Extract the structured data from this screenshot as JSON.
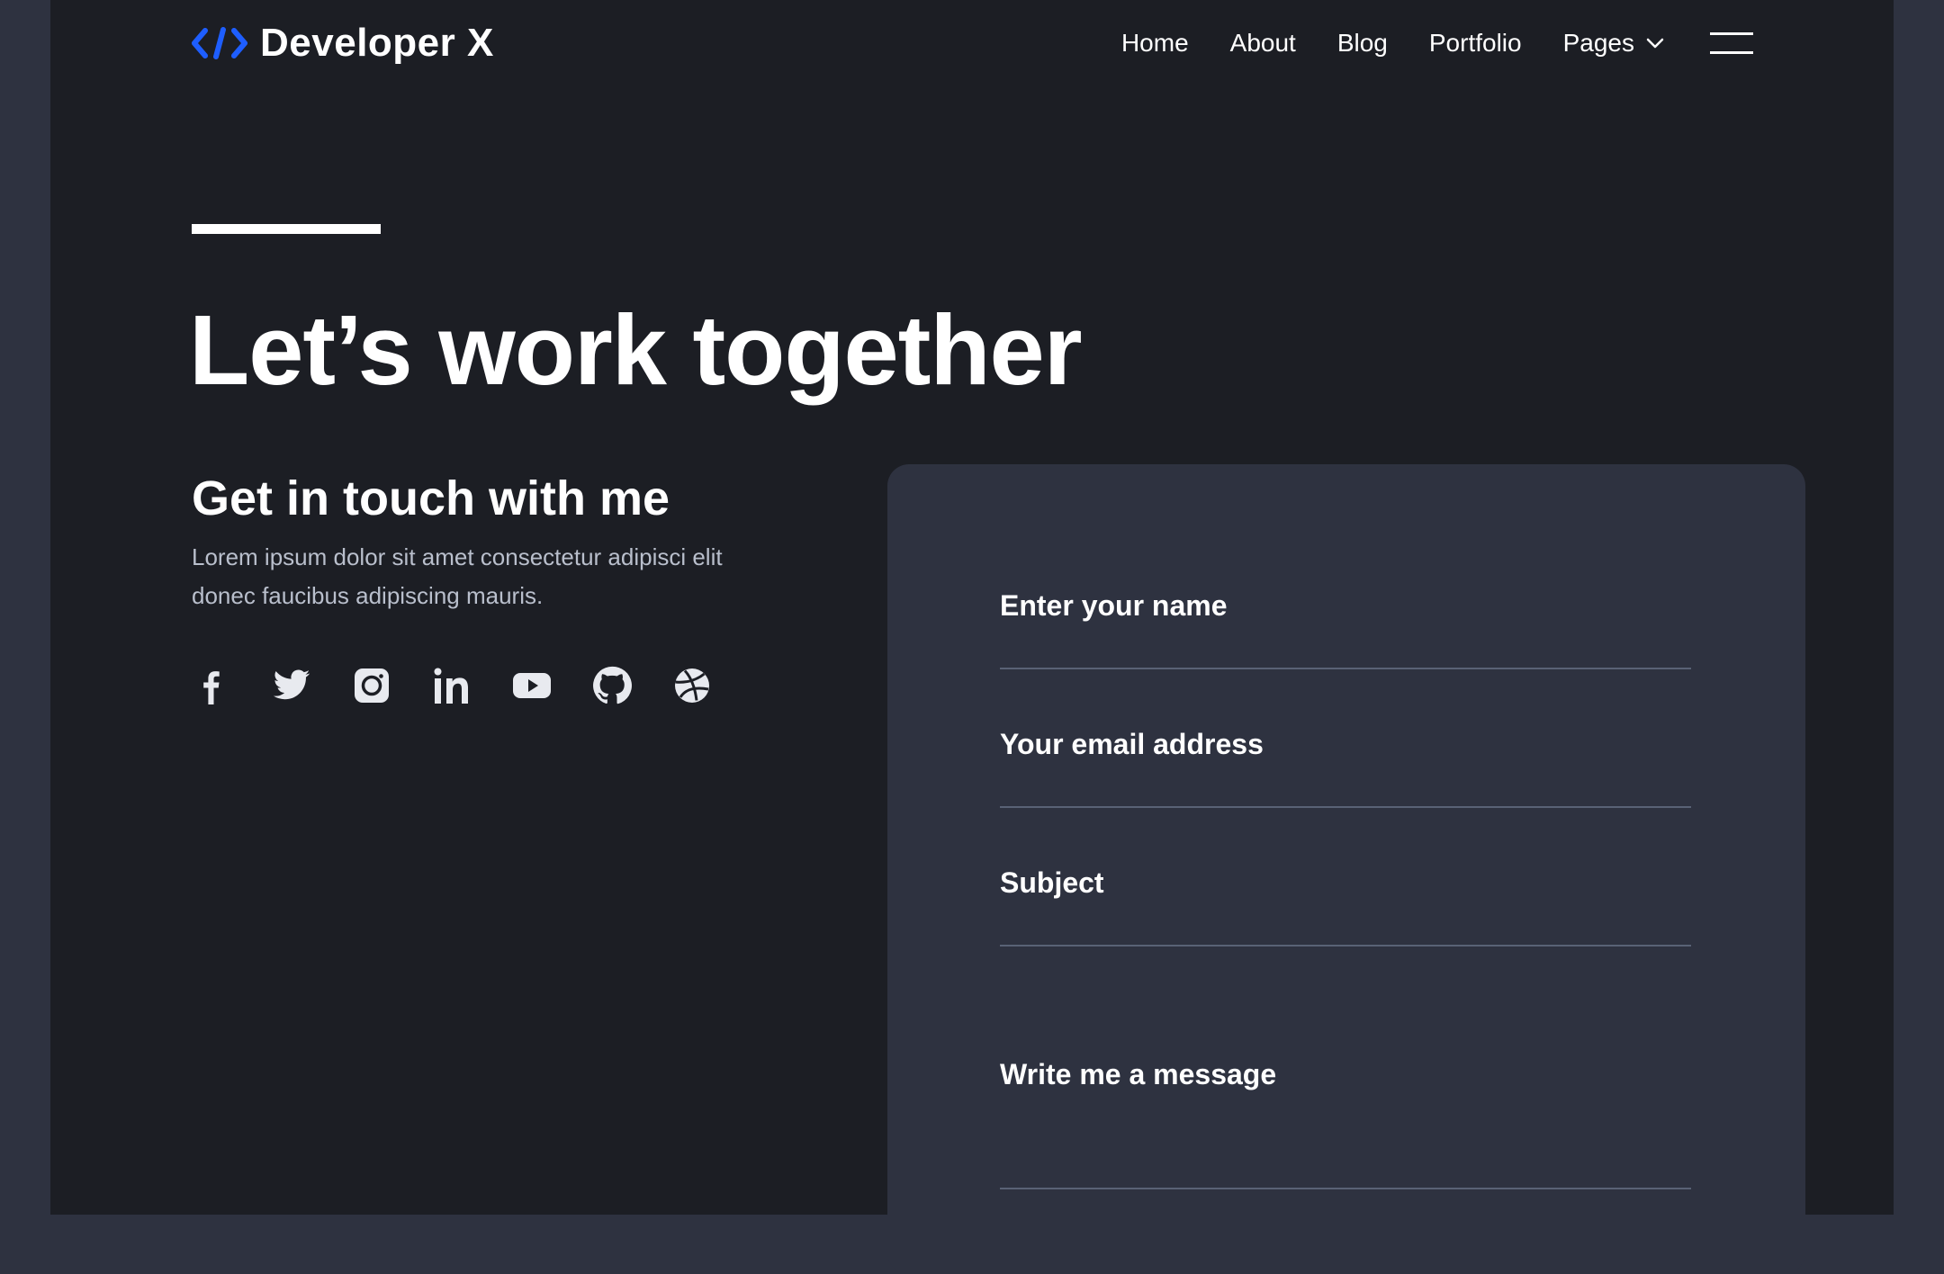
{
  "brand": {
    "name": "Developer X",
    "logo_icon": "code-brackets-icon",
    "accent_color": "#1e5eff"
  },
  "nav": {
    "items": [
      {
        "label": "Home"
      },
      {
        "label": "About"
      },
      {
        "label": "Blog"
      },
      {
        "label": "Portfolio"
      },
      {
        "label": "Pages"
      }
    ],
    "menu_icon": "hamburger-menu-icon"
  },
  "hero": {
    "title": "Let’s work together"
  },
  "contact": {
    "title": "Get in touch with me",
    "text": "Lorem ipsum dolor sit amet consectetur adipisci elit donec faucibus adipiscing mauris.",
    "social": [
      "facebook-icon",
      "twitter-icon",
      "instagram-icon",
      "linkedin-icon",
      "youtube-icon",
      "github-icon",
      "dribbble-icon"
    ]
  },
  "form": {
    "name_placeholder": "Enter your name",
    "email_placeholder": "Your email address",
    "subject_placeholder": "Subject",
    "message_placeholder": "Write me a message"
  },
  "colors": {
    "background": "#1c1e24",
    "card": "#2e3240",
    "outer": "#2e3240",
    "field_line": "#596275",
    "muted_text": "#b9bfcc"
  }
}
